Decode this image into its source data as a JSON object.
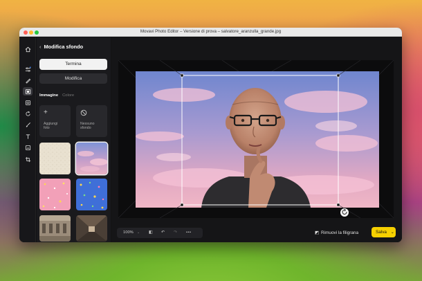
{
  "window": {
    "title": "Movavi Photo Editor – Versione di prova – salvatore_aranzulla_grande.jpg"
  },
  "panel": {
    "title": "Modifica sfondo",
    "done_label": "Termina",
    "edit_label": "Modifica",
    "tabs": [
      "Immagine",
      "Colore"
    ],
    "add_photo": "Aggiungi foto",
    "no_background": "Nessuno sfondo"
  },
  "toolbar": {
    "icons": [
      "home-icon",
      "adjust-icon",
      "retouch-icon",
      "background-icon",
      "filters-icon",
      "rotate-icon",
      "brush-icon",
      "text-icon",
      "frame-icon",
      "crop-icon"
    ],
    "active_tool": "background-icon"
  },
  "bottom": {
    "zoom": "100%",
    "remove_watermark": "Rimuovi la filigrana",
    "save_label": "Salva"
  },
  "colors": {
    "accent": "#f6d000",
    "panel_bg": "#1a1a1d",
    "canvas_bg": "#151517"
  }
}
